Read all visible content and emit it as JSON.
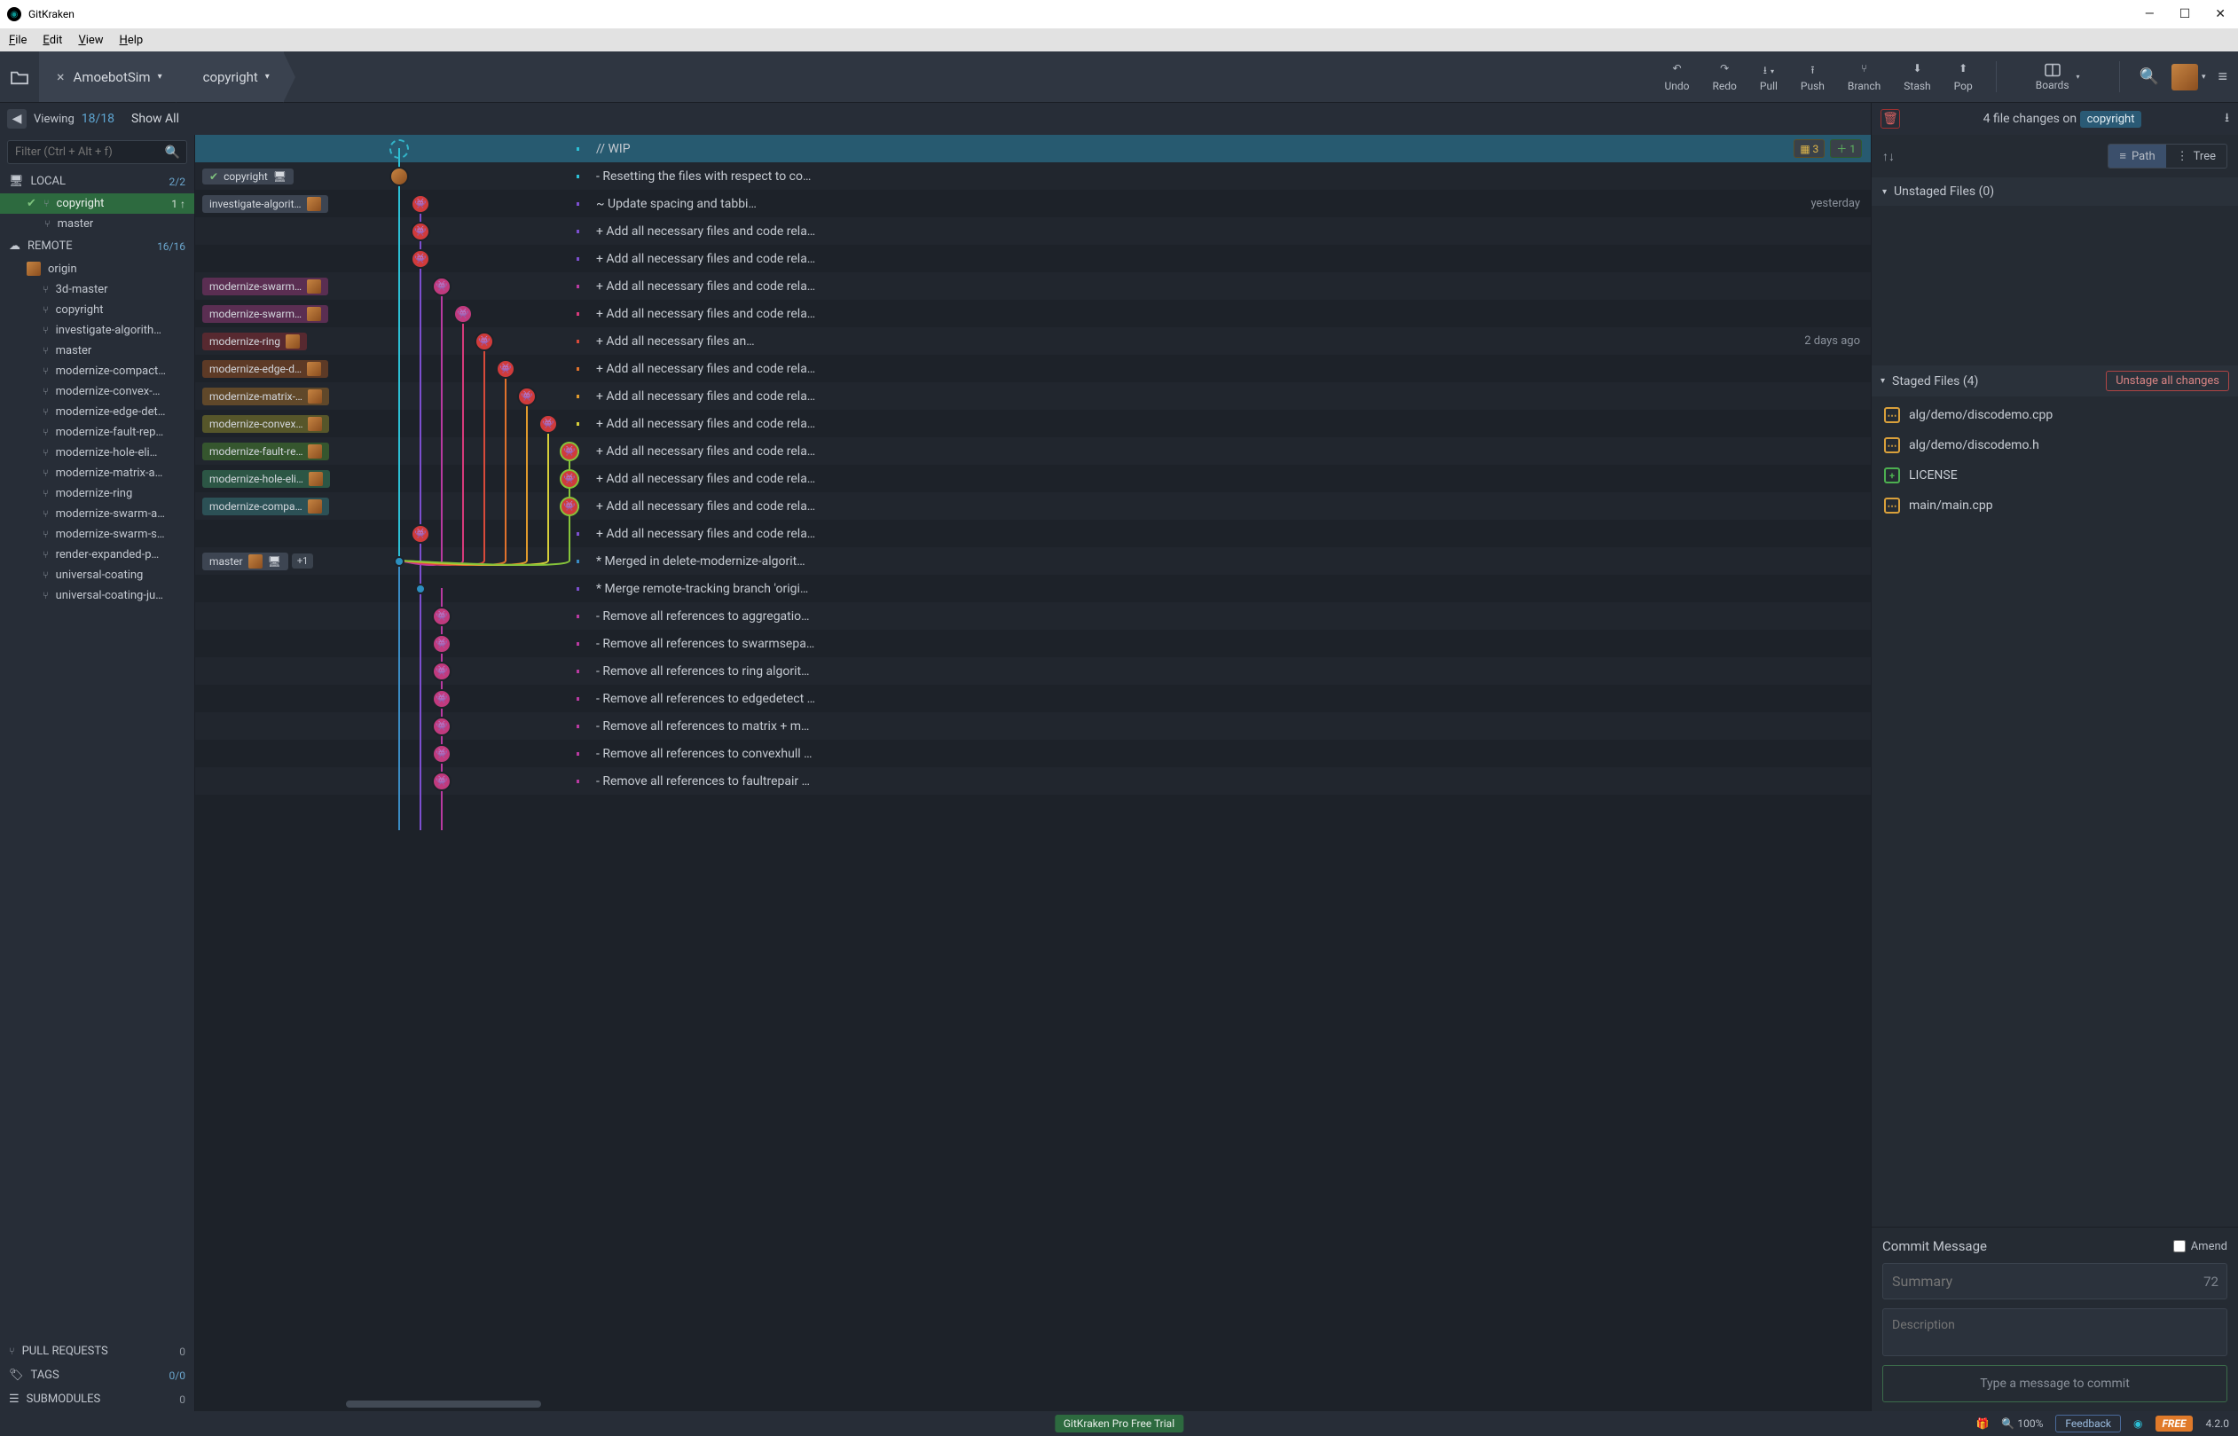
{
  "app": {
    "title": "GitKraken"
  },
  "menu": [
    "File",
    "Edit",
    "View",
    "Help"
  ],
  "breadcrumb": {
    "repo": "AmoebotSim",
    "branch": "copyright"
  },
  "toolbar": {
    "undo": "Undo",
    "redo": "Redo",
    "pull": "Pull",
    "push": "Push",
    "branch": "Branch",
    "stash": "Stash",
    "pop": "Pop",
    "boards": "Boards"
  },
  "subhead": {
    "viewing": "Viewing",
    "nums": "18/18",
    "showall": "Show All",
    "changes_pre": "4 file changes on",
    "changes_branch": "copyright"
  },
  "filter": {
    "placeholder": "Filter (Ctrl + Alt + f)"
  },
  "sidebar": {
    "local": {
      "label": "LOCAL",
      "count": "2/2",
      "items": [
        {
          "name": "copyright",
          "active": true,
          "count": "1 ↑"
        },
        {
          "name": "master"
        }
      ]
    },
    "remote": {
      "label": "REMOTE",
      "count": "16/16",
      "origin": "origin",
      "items": [
        "3d-master",
        "copyright",
        "investigate-algorith…",
        "master",
        "modernize-compact…",
        "modernize-convex-…",
        "modernize-edge-det…",
        "modernize-fault-rep…",
        "modernize-hole-eli…",
        "modernize-matrix-a…",
        "modernize-ring",
        "modernize-swarm-a…",
        "modernize-swarm-s…",
        "render-expanded-p…",
        "universal-coating",
        "universal-coating-ju…"
      ]
    },
    "pulls": {
      "label": "PULL REQUESTS",
      "count": "0"
    },
    "tags": {
      "label": "TAGS",
      "count": "0/0"
    },
    "subs": {
      "label": "SUBMODULES",
      "count": "0"
    }
  },
  "graph": {
    "rows": [
      {
        "labels": [],
        "wip": true,
        "msg": "// WIP",
        "lanes": "dash@0",
        "meta": {
          "mod": "3",
          "add": "1"
        },
        "sel": true,
        "bar": "#2cc0d6"
      },
      {
        "labels": [
          {
            "txt": "copyright",
            "check": true,
            "lap": true
          }
        ],
        "msg": "- Resetting the files with respect to co…",
        "lanes": "av@0",
        "bar": "#2cc0d6"
      },
      {
        "labels": [
          {
            "txt": "investigate-algorit…",
            "av": true
          }
        ],
        "msg": "~ Update spacing and tabbi…",
        "time": "yesterday",
        "lanes": "red@1",
        "bar": "#7c4fcf"
      },
      {
        "msg": "+ Add all necessary files and code rela…",
        "lanes": "red@1",
        "bar": "#7c4fcf"
      },
      {
        "msg": "+ Add all necessary files and code rela…",
        "lanes": "red@1",
        "bar": "#7c4fcf"
      },
      {
        "labels": [
          {
            "txt": "modernize-swarm…",
            "av": true,
            "col": "#5a2e52"
          }
        ],
        "msg": "+ Add all necessary files and code rela…",
        "lanes": "pink@2",
        "bar": "#b93aa1"
      },
      {
        "labels": [
          {
            "txt": "modernize-swarm…",
            "av": true,
            "col": "#5a2e52"
          }
        ],
        "msg": "+ Add all necessary files and code rela…",
        "lanes": "pink@3",
        "bar": "#d73a7b"
      },
      {
        "labels": [
          {
            "txt": "modernize-ring",
            "av": true,
            "col": "#572930"
          }
        ],
        "msg": "+ Add all necessary files an…",
        "time": "2 days ago",
        "lanes": "red@4",
        "bar": "#d84a3a"
      },
      {
        "labels": [
          {
            "txt": "modernize-edge-d…",
            "av": true,
            "col": "#5d3a26"
          }
        ],
        "msg": "+ Add all necessary files and code rela…",
        "lanes": "red@5",
        "bar": "#e0722c"
      },
      {
        "labels": [
          {
            "txt": "modernize-matrix-…",
            "av": true,
            "col": "#60482a"
          }
        ],
        "msg": "+ Add all necessary files and code rela…",
        "lanes": "red@6",
        "bar": "#e09a2c"
      },
      {
        "labels": [
          {
            "txt": "modernize-convex…",
            "av": true,
            "col": "#56562a"
          }
        ],
        "msg": "+ Add all necessary files and code rela…",
        "lanes": "red@7",
        "bar": "#d7cf3a"
      },
      {
        "labels": [
          {
            "txt": "modernize-fault-re…",
            "av": true,
            "col": "#35562e"
          }
        ],
        "msg": "+ Add all necessary files and code rela…",
        "lanes": "red@8,ol",
        "bar": "#86c43a"
      },
      {
        "labels": [
          {
            "txt": "modernize-hole-eli…",
            "av": true,
            "col": "#2c5645"
          }
        ],
        "msg": "+ Add all necessary files and code rela…",
        "lanes": "red@8,ol",
        "bar": "#3ac475"
      },
      {
        "labels": [
          {
            "txt": "modernize-compa…",
            "av": true,
            "col": "#2c5156"
          }
        ],
        "msg": "+ Add all necessary files and code rela…",
        "lanes": "red@8,ol",
        "bar": "#3ab9c4"
      },
      {
        "msg": "+ Add all necessary files and code rela…",
        "lanes": "red@1",
        "bar": "#7c4fcf"
      },
      {
        "labels": [
          {
            "txt": "master",
            "av": true,
            "lap": true
          },
          {
            "plus": "+1"
          }
        ],
        "msg": "* Merged in delete-modernize-algorit…",
        "lanes": "blue@0,merge",
        "bar": "#3a8cc4"
      },
      {
        "msg": "* Merge remote-tracking branch 'origi…",
        "lanes": "blue@1,small",
        "bar": "#7c4fcf"
      },
      {
        "msg": "- Remove all references to aggregatio…",
        "lanes": "pink@2",
        "bar": "#b93aa1"
      },
      {
        "msg": "- Remove all references to swarmsepa…",
        "lanes": "pink@2",
        "bar": "#b93aa1"
      },
      {
        "msg": "- Remove all references to ring algorit…",
        "lanes": "pink@2",
        "bar": "#b93aa1"
      },
      {
        "msg": "- Remove all references to edgedetect …",
        "lanes": "pink@2",
        "bar": "#b93aa1"
      },
      {
        "msg": "- Remove all references to matrix + m…",
        "lanes": "pink@2",
        "bar": "#b93aa1"
      },
      {
        "msg": "- Remove all references to convexhull …",
        "lanes": "pink@2",
        "bar": "#b93aa1"
      },
      {
        "msg": "- Remove all references to faultrepair …",
        "lanes": "pink@2",
        "bar": "#b93aa1"
      }
    ]
  },
  "rpanel": {
    "path": "Path",
    "tree": "Tree",
    "unstaged": "Unstaged Files (0)",
    "staged": "Staged Files (4)",
    "unstage_btn": "Unstage all changes",
    "files": [
      {
        "name": "alg/demo/discodemo.cpp",
        "type": "mod"
      },
      {
        "name": "alg/demo/discodemo.h",
        "type": "mod"
      },
      {
        "name": "LICENSE",
        "type": "add"
      },
      {
        "name": "main/main.cpp",
        "type": "mod"
      }
    ],
    "commit_label": "Commit Message",
    "amend": "Amend",
    "summary_ph": "Summary",
    "summary_cnt": "72",
    "desc_ph": "Description",
    "commit_btn": "Type a message to commit"
  },
  "status": {
    "trial": "GitKraken Pro Free Trial",
    "zoom": "100%",
    "feedback": "Feedback",
    "free": "FREE",
    "ver": "4.2.0"
  },
  "laneColors": [
    "#2cc0d6",
    "#7c4fcf",
    "#b93aa1",
    "#d73a7b",
    "#d84a3a",
    "#e0722c",
    "#e09a2c",
    "#d7cf3a",
    "#86c43a",
    "#3ac475",
    "#3ab9c4"
  ]
}
